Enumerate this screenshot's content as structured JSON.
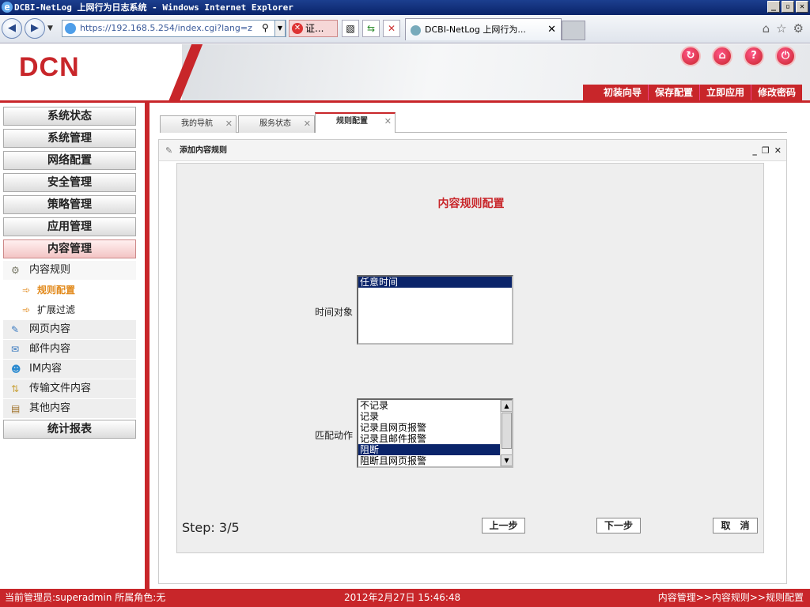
{
  "window": {
    "title": "DCBI-NetLog 上网行为日志系统 - Windows Internet Explorer"
  },
  "browser": {
    "address": "https://192.168.5.254/index.cgi?lang=z",
    "cert_label": "证...",
    "tab_title": "DCBI-NetLog 上网行为..."
  },
  "header": {
    "logo": "DCN",
    "menu": [
      "初装向导",
      "保存配置",
      "立即应用",
      "修改密码"
    ]
  },
  "sidebar": {
    "categories": {
      "status": "系统状态",
      "sysmgmt": "系统管理",
      "network": "网络配置",
      "security": "安全管理",
      "policy": "策略管理",
      "app": "应用管理",
      "content": "内容管理",
      "report": "统计报表"
    },
    "sub": {
      "content_rules": "内容规则",
      "web": "网页内容",
      "mail": "邮件内容",
      "im": "IM内容",
      "transfer": "传输文件内容",
      "other": "其他内容"
    },
    "leaves": {
      "rule_config": "规则配置",
      "ext_filter": "扩展过滤"
    }
  },
  "tabs": [
    "我的导航",
    "服务状态",
    "规则配置"
  ],
  "panel": {
    "title": "添加内容规则",
    "form_title": "内容规则配置",
    "time_label": "时间对象",
    "time_options": [
      "任意时间"
    ],
    "action_label": "匹配动作",
    "action_options": [
      "不记录",
      "记录",
      "记录且网页报警",
      "记录且邮件报警",
      "阻断",
      "阻断且网页报警"
    ],
    "action_selected": "阻断",
    "step": "Step: 3/5",
    "prev_button": "上一步",
    "next_button": "下一步",
    "cancel_button": "取　消"
  },
  "statusbar": {
    "user": "当前管理员:superadmin  所属角色:无",
    "datetime": "2012年2月27日 15:46:48",
    "breadcrumb": "内容管理>>内容规则>>规则配置"
  },
  "colors": {
    "brand": "#c8262a",
    "highlight": "#e28a1c",
    "selection": "#0a246a"
  }
}
